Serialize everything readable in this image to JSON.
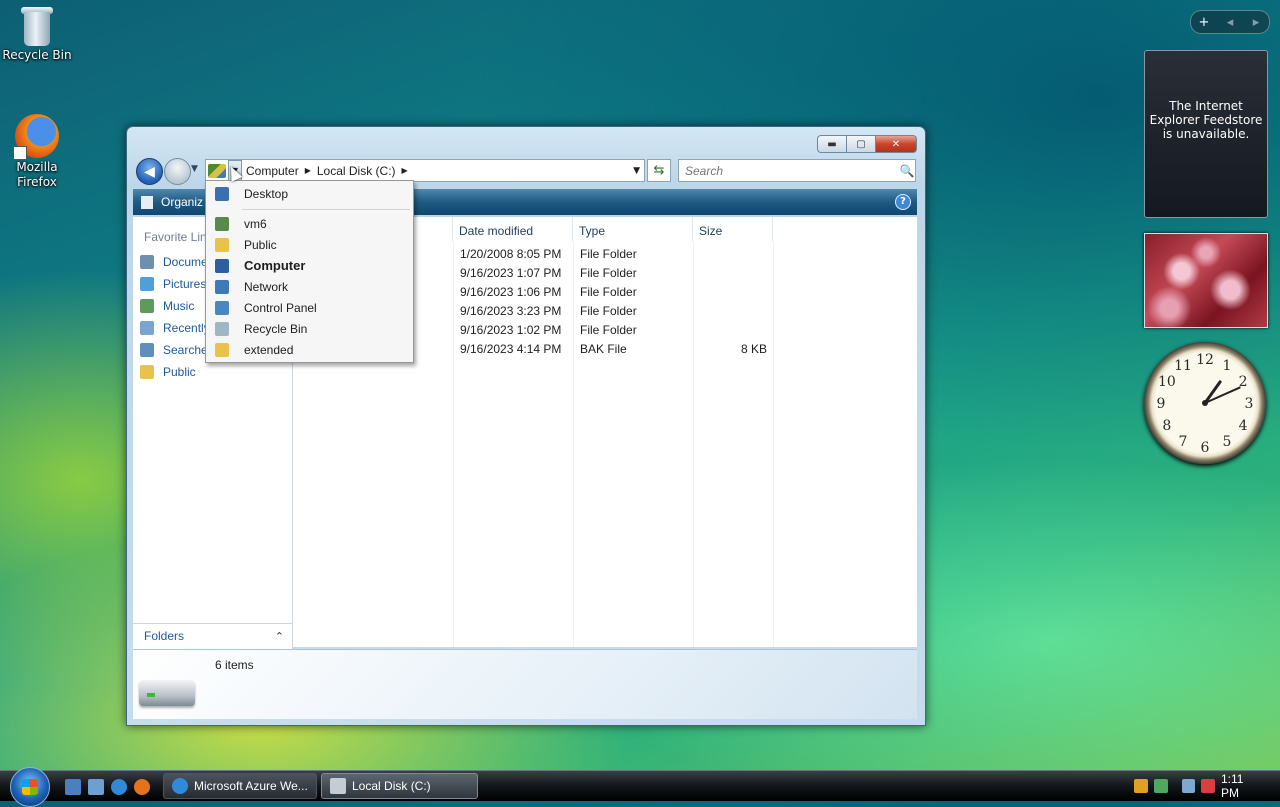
{
  "desktop": {
    "icons": [
      {
        "label": "Recycle Bin"
      },
      {
        "label": "Mozilla Firefox"
      }
    ]
  },
  "gadgets": {
    "controls": {
      "add": "+",
      "prev": "◂",
      "next": "▸"
    },
    "feed_message": "The Internet Explorer Feedstore is unavailable.",
    "clock": {
      "hour": 1,
      "minute": 11,
      "numerals": [
        "12",
        "1",
        "2",
        "3",
        "4",
        "5",
        "6",
        "7",
        "8",
        "9",
        "10",
        "11"
      ]
    }
  },
  "window": {
    "controls": {
      "minimize": "▬",
      "maximize": "▢",
      "close": "✕"
    },
    "nav": {
      "back": "◀",
      "recent": "▼"
    },
    "address": {
      "crumbs": [
        "Computer",
        "Local Disk (C:)"
      ],
      "separator": "▶",
      "dropdown_arrow": "▼"
    },
    "search": {
      "placeholder": "Search",
      "icon": "🔍"
    },
    "toolbar": {
      "organize": "Organiz",
      "help": "?"
    },
    "nav_pane": {
      "heading": "Favorite Lin",
      "items": [
        "Docume",
        "Pictures",
        "Music",
        "Recently",
        "Searche",
        "Public"
      ],
      "folders_label": "Folders",
      "folders_chevron": "⌃"
    },
    "columns": [
      "Date modified",
      "Type",
      "Size"
    ],
    "rows": [
      {
        "date": "1/20/2008 8:05 PM",
        "type": "File Folder",
        "size": ""
      },
      {
        "date": "9/16/2023 1:07 PM",
        "type": "File Folder",
        "size": ""
      },
      {
        "date": "9/16/2023 1:06 PM",
        "type": "File Folder",
        "size": ""
      },
      {
        "date": "9/16/2023 3:23 PM",
        "type": "File Folder",
        "size": ""
      },
      {
        "date": "9/16/2023 1:02 PM",
        "type": "File Folder",
        "size": ""
      },
      {
        "date": "9/16/2023 4:14 PM",
        "type": "BAK File",
        "size": "8 KB"
      }
    ],
    "details": {
      "item_count": "6 items"
    }
  },
  "address_dropdown": {
    "items": [
      {
        "label": "Desktop",
        "icon": "desktop-icon",
        "color": "#3a6fb0",
        "bold": false
      },
      {
        "label": "vm6",
        "icon": "user-folder-icon",
        "color": "#5a8a4a",
        "bold": false
      },
      {
        "label": "Public",
        "icon": "folder-icon",
        "color": "#e8c24a",
        "bold": false
      },
      {
        "label": "Computer",
        "icon": "computer-icon",
        "color": "#2d5fa0",
        "bold": true
      },
      {
        "label": "Network",
        "icon": "network-icon",
        "color": "#3f7ab8",
        "bold": false
      },
      {
        "label": "Control Panel",
        "icon": "control-panel-icon",
        "color": "#4a86c0",
        "bold": false
      },
      {
        "label": "Recycle Bin",
        "icon": "recycle-bin-icon",
        "color": "#9fb6c4",
        "bold": false
      },
      {
        "label": "extended",
        "icon": "folder-icon",
        "color": "#e8c24a",
        "bold": false
      }
    ]
  },
  "taskbar": {
    "buttons": [
      {
        "label": "Microsoft Azure We...",
        "icon": "ie-icon"
      },
      {
        "label": "Local Disk (C:)",
        "icon": "drive-icon"
      }
    ],
    "time": "1:11 PM"
  }
}
